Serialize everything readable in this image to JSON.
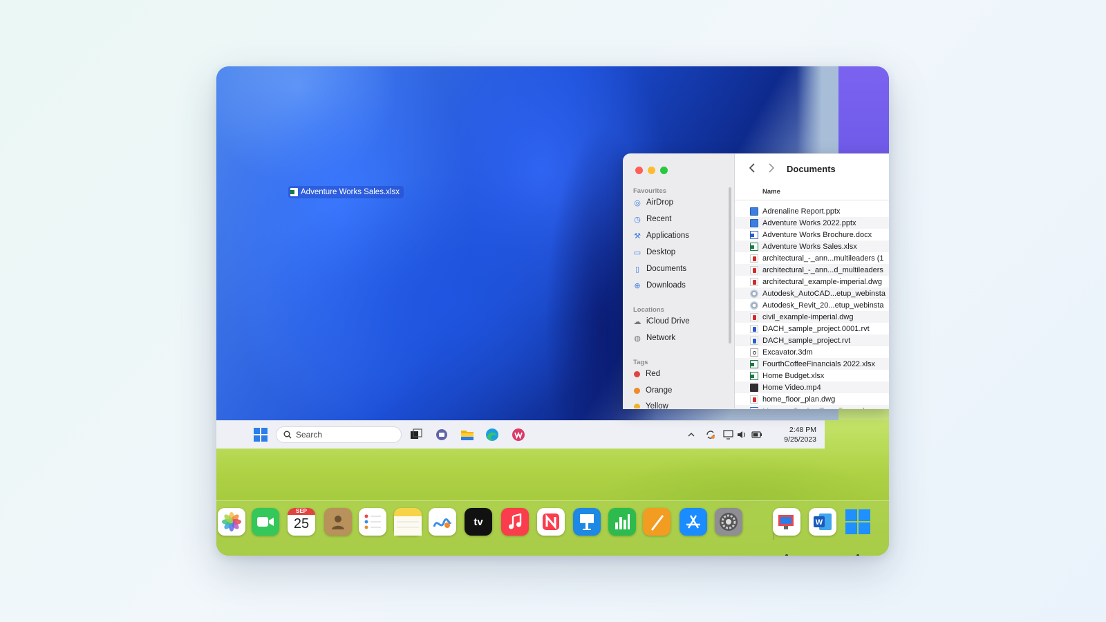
{
  "desktop": {
    "file_label": "Adventure Works Sales.xlsx"
  },
  "taskbar": {
    "search_placeholder": "Search",
    "time": "2:48 PM",
    "date": "9/25/2023",
    "icons": [
      "windows-start-icon",
      "search-icon",
      "task-view-icon",
      "teams-chat-icon",
      "file-explorer-icon",
      "edge-icon",
      "office-icon"
    ],
    "tray_icons": [
      "chevron-up-icon",
      "sync-icon",
      "display-icon",
      "volume-icon",
      "battery-icon"
    ]
  },
  "finder": {
    "title": "Documents",
    "sidebar": {
      "favourites_heading": "Favourites",
      "favourites": [
        {
          "label": "AirDrop",
          "icon": "airdrop-icon"
        },
        {
          "label": "Recent",
          "icon": "clock-icon"
        },
        {
          "label": "Applications",
          "icon": "applications-icon"
        },
        {
          "label": "Desktop",
          "icon": "desktop-icon"
        },
        {
          "label": "Documents",
          "icon": "document-icon"
        },
        {
          "label": "Downloads",
          "icon": "download-icon"
        }
      ],
      "locations_heading": "Locations",
      "locations": [
        {
          "label": "iCloud Drive",
          "icon": "cloud-icon"
        },
        {
          "label": "Network",
          "icon": "globe-icon"
        }
      ],
      "tags_heading": "Tags",
      "tags": [
        {
          "label": "Red",
          "color": "#e0443e"
        },
        {
          "label": "Orange",
          "color": "#f0892b"
        },
        {
          "label": "Yellow",
          "color": "#f0b22b"
        }
      ]
    },
    "column_name": "Name",
    "files": [
      {
        "name": "Adrenaline Report.pptx",
        "type": "pptx"
      },
      {
        "name": "Adventure Works 2022.pptx",
        "type": "pptx"
      },
      {
        "name": "Adventure Works Brochure.docx",
        "type": "docx"
      },
      {
        "name": "Adventure Works Sales.xlsx",
        "type": "xlsx"
      },
      {
        "name": "architectural_-_ann...multileaders (1",
        "type": "dwg"
      },
      {
        "name": "architectural_-_ann...d_multileaders",
        "type": "dwg"
      },
      {
        "name": "architectural_example-imperial.dwg",
        "type": "dwg"
      },
      {
        "name": "Autodesk_AutoCAD...etup_webinsta",
        "type": "pkg"
      },
      {
        "name": "Autodesk_Revit_20...etup_webinsta",
        "type": "pkg"
      },
      {
        "name": "civil_example-imperial.dwg",
        "type": "dwg"
      },
      {
        "name": "DACH_sample_project.0001.rvt",
        "type": "rvt"
      },
      {
        "name": "DACH_sample_project.rvt",
        "type": "rvt"
      },
      {
        "name": "Excavator.3dm",
        "type": "tdm"
      },
      {
        "name": "FourthCoffeeFinancials 2022.xlsx",
        "type": "xlsx"
      },
      {
        "name": "Home Budget.xlsx",
        "type": "xlsx"
      },
      {
        "name": "Home Video.mp4",
        "type": "mp4"
      },
      {
        "name": "home_floor_plan.dwg",
        "type": "dwg"
      },
      {
        "name": "Museum Design Term Paper.docx",
        "type": "docx"
      }
    ]
  },
  "dock": {
    "calendar_month": "SEP",
    "calendar_day": "25",
    "tv_label": "tv",
    "apps": [
      {
        "name": "photos-app-icon",
        "color": "#ffffff"
      },
      {
        "name": "facetime-app-icon",
        "color": "#34c759"
      },
      {
        "name": "calendar-app-icon",
        "color": "#ffffff"
      },
      {
        "name": "contacts-app-icon",
        "color": "#b8915b"
      },
      {
        "name": "reminders-app-icon",
        "color": "#ffffff"
      },
      {
        "name": "notes-app-icon",
        "color": "#f7d34a"
      },
      {
        "name": "freeform-app-icon",
        "color": "#ffffff"
      },
      {
        "name": "apple-tv-app-icon",
        "color": "#111111"
      },
      {
        "name": "music-app-icon",
        "color": "#fa3c4c"
      },
      {
        "name": "news-app-icon",
        "color": "#ffffff"
      },
      {
        "name": "keynote-app-icon",
        "color": "#1e88e5"
      },
      {
        "name": "numbers-app-icon",
        "color": "#2dbb4e"
      },
      {
        "name": "pages-app-icon",
        "color": "#f39c22"
      },
      {
        "name": "app-store-icon",
        "color": "#1a8cff"
      },
      {
        "name": "system-settings-icon",
        "color": "#8e8e93"
      },
      {
        "name": "remote-desktop-app-icon",
        "color": "#ffffff"
      },
      {
        "name": "word-app-icon",
        "color": "#ffffff"
      },
      {
        "name": "windows-app-icon",
        "color": "#1e90ff"
      }
    ]
  }
}
